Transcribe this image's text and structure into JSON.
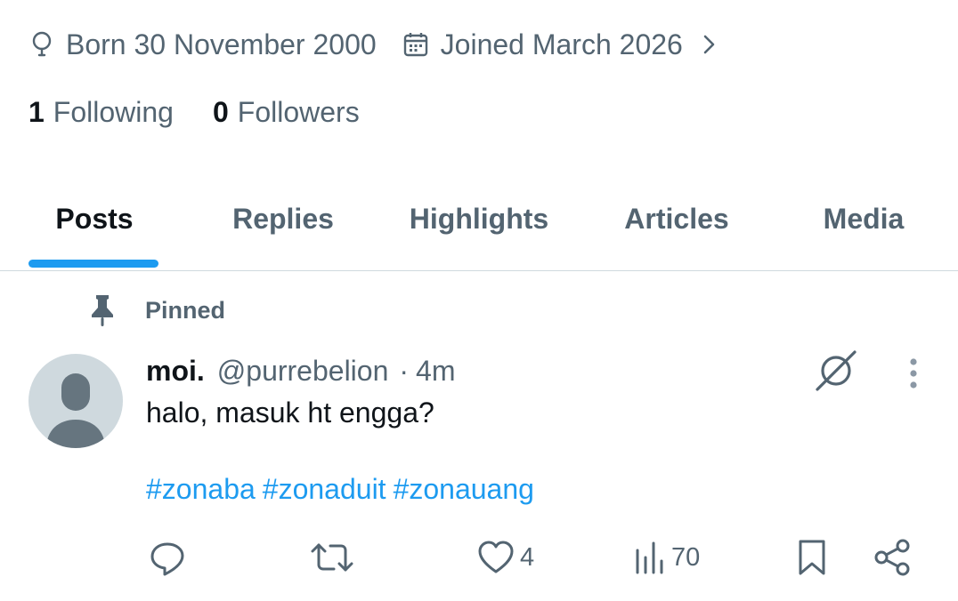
{
  "profile_meta": {
    "born": "Born 30 November 2000",
    "joined": "Joined March 2026"
  },
  "follow_stats": {
    "following_count": "1",
    "following_label": "Following",
    "followers_count": "0",
    "followers_label": "Followers"
  },
  "tabs": [
    {
      "label": "Posts",
      "active": true
    },
    {
      "label": "Replies",
      "active": false
    },
    {
      "label": "Highlights",
      "active": false
    },
    {
      "label": "Articles",
      "active": false
    },
    {
      "label": "Media",
      "active": false
    }
  ],
  "pinned_label": "Pinned",
  "post": {
    "display_name": "moi.",
    "handle": "@purrebelion",
    "separator": "·",
    "time": "4m",
    "text": "halo, masuk ht engga?",
    "hashtags": [
      "#zonaba",
      "#zonaduit",
      "#zonauang"
    ],
    "actions": {
      "reply_count": "",
      "repost_count": "",
      "like_count": "4",
      "views_count": "70"
    }
  },
  "colors": {
    "accent": "#1d9bf0",
    "text_primary": "#0f1419",
    "text_secondary": "#536471",
    "divider": "#cfd9de"
  },
  "icons": [
    "location-icon",
    "calendar-icon",
    "chevron-right-icon",
    "pin-icon",
    "avatar-placeholder-icon",
    "grok-icon",
    "more-vertical-icon",
    "reply-icon",
    "repost-icon",
    "like-icon",
    "views-icon",
    "bookmark-icon",
    "share-icon"
  ]
}
